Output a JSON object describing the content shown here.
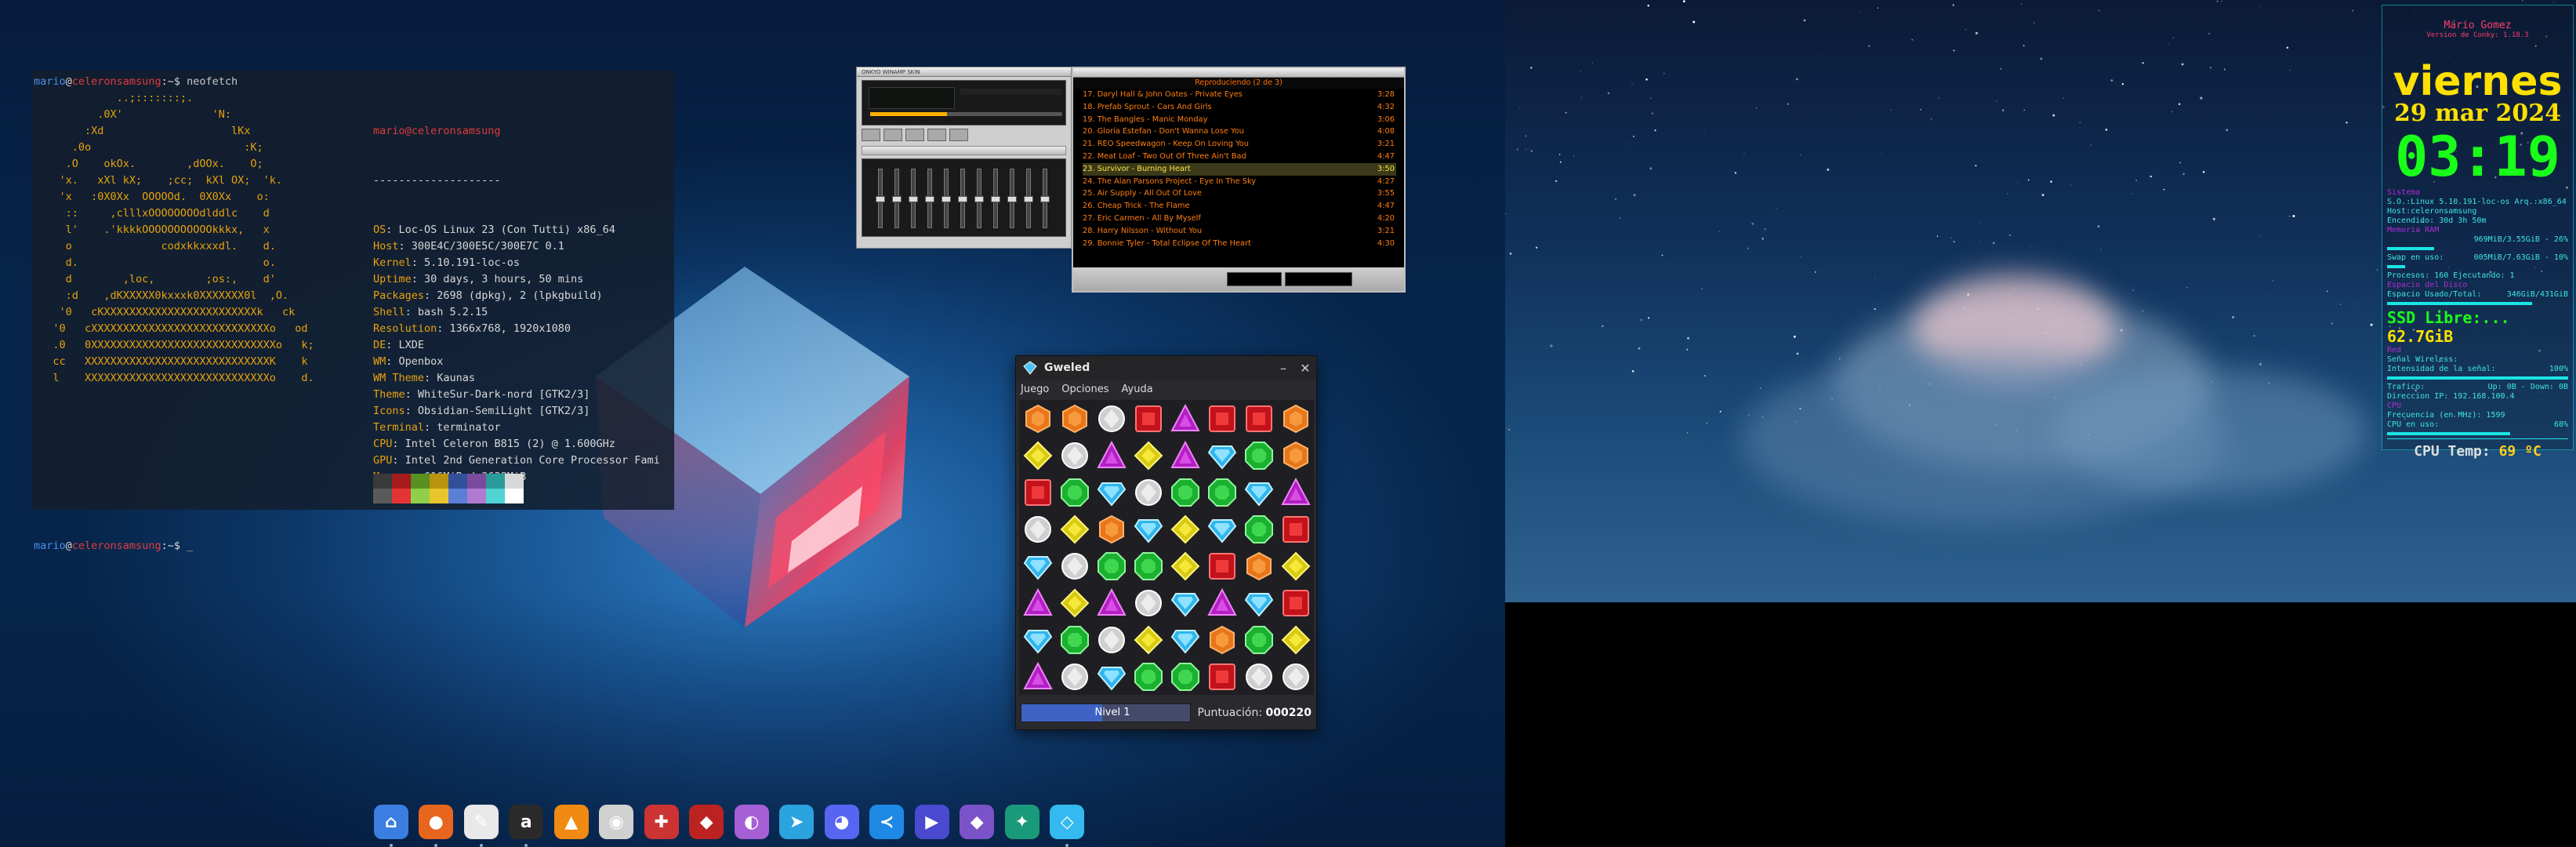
{
  "terminal": {
    "user": "mario",
    "host": "celeronsamsung",
    "command": "neofetch",
    "header": "mario@celeronsamsung",
    "separator": "--------------------",
    "info": [
      {
        "key": "OS",
        "value": "Loc-OS Linux 23 (Con Tutti) x86_64"
      },
      {
        "key": "Host",
        "value": "300E4C/300E5C/300E7C 0.1"
      },
      {
        "key": "Kernel",
        "value": "5.10.191-loc-os"
      },
      {
        "key": "Uptime",
        "value": "30 days, 3 hours, 50 mins"
      },
      {
        "key": "Packages",
        "value": "2698 (dpkg), 2 (lpkgbuild)"
      },
      {
        "key": "Shell",
        "value": "bash 5.2.15"
      },
      {
        "key": "Resolution",
        "value": "1366x768, 1920x1080"
      },
      {
        "key": "DE",
        "value": "LXDE"
      },
      {
        "key": "WM",
        "value": "Openbox"
      },
      {
        "key": "WM Theme",
        "value": "Kaunas"
      },
      {
        "key": "Theme",
        "value": "WhiteSur-Dark-nord [GTK2/3]"
      },
      {
        "key": "Icons",
        "value": "Obsidian-SemiLight [GTK2/3]"
      },
      {
        "key": "Terminal",
        "value": "terminator"
      },
      {
        "key": "CPU",
        "value": "Intel Celeron B815 (2) @ 1.600GHz"
      },
      {
        "key": "GPU",
        "value": "Intel 2nd Generation Core Processor Fami"
      },
      {
        "key": "Memory",
        "value": "616MiB / 3638MiB"
      }
    ],
    "swatch_colors": [
      "#3a3a3a",
      "#a61c1c",
      "#5a8f22",
      "#b8940f",
      "#32509a",
      "#7a4a9c",
      "#2b9a9a",
      "#d8d8d8",
      "#5a5a5a",
      "#e53434",
      "#8ed04a",
      "#e8c52c",
      "#5b7fd6",
      "#b07ad1",
      "#4fd3d3",
      "#ffffff"
    ],
    "cursor": "_"
  },
  "winamp": {
    "main_title": "ONKYO WINAMP SKIN",
    "playlist_header": "Reproduciendo (2 de 3)",
    "tracks": [
      {
        "title": "17. Daryl Hall & John Oates - Private Eyes",
        "time": "3:28"
      },
      {
        "title": "18. Prefab Sprout - Cars And Girls",
        "time": "4:32"
      },
      {
        "title": "19. The Bangles - Manic Monday",
        "time": "3:06"
      },
      {
        "title": "20. Gloria Estefan - Don't Wanna Lose You",
        "time": "4:08"
      },
      {
        "title": "21. REO Speedwagon - Keep On Loving You",
        "time": "3:21"
      },
      {
        "title": "22. Meat Loaf - Two Out Of Three Ain't Bad",
        "time": "4:47"
      },
      {
        "title": "23. Survivor - Burning Heart",
        "time": "3:50"
      },
      {
        "title": "24. The Alan Parsons Project - Eye In The Sky",
        "time": "4:27"
      },
      {
        "title": "25. Air Supply - All Out Of Love",
        "time": "3:55"
      },
      {
        "title": "26. Cheap Trick - The Flame",
        "time": "4:47"
      },
      {
        "title": "27. Eric Carmen - All By Myself",
        "time": "4:20"
      },
      {
        "title": "28. Harry Nilsson - Without You",
        "time": "3:21"
      },
      {
        "title": "29. Bonnie Tyler - Total Eclipse Of The Heart",
        "time": "4:30"
      }
    ],
    "current_index": 6
  },
  "gweled": {
    "title": "Gweled",
    "menu": [
      "Juego",
      "Opciones",
      "Ayuda"
    ],
    "level_label": "Nivel 1",
    "level_progress": 0.48,
    "score_label": "Puntuación:",
    "score_value": "000220",
    "board": [
      [
        "orange",
        "orange",
        "white",
        "red",
        "purple",
        "red",
        "red",
        "orange"
      ],
      [
        "yellow",
        "white",
        "purple",
        "yellow",
        "purple",
        "blue",
        "green",
        "orange"
      ],
      [
        "red",
        "green",
        "blue",
        "white",
        "green",
        "green",
        "blue",
        "purple"
      ],
      [
        "white",
        "yellow",
        "orange",
        "blue",
        "yellow",
        "blue",
        "green",
        "red"
      ],
      [
        "blue",
        "white",
        "green",
        "green",
        "yellow",
        "red",
        "orange",
        "yellow"
      ],
      [
        "purple",
        "yellow",
        "purple",
        "white",
        "blue",
        "purple",
        "blue",
        "red"
      ],
      [
        "blue",
        "green",
        "white",
        "yellow",
        "blue",
        "orange",
        "green",
        "yellow"
      ],
      [
        "purple",
        "white",
        "blue",
        "green",
        "green",
        "red",
        "white",
        "white"
      ]
    ]
  },
  "dock": [
    {
      "name": "home-folder-icon",
      "color": "#3b7de0",
      "glyph": "⌂"
    },
    {
      "name": "firefox-icon",
      "color": "#e8651d",
      "glyph": "●"
    },
    {
      "name": "text-editor-icon",
      "color": "#e8e8e8",
      "glyph": "✎"
    },
    {
      "name": "archive-icon",
      "color": "#2a2a2a",
      "glyph": "a"
    },
    {
      "name": "vlc-icon",
      "color": "#f08a12",
      "glyph": "▲"
    },
    {
      "name": "webcam-icon",
      "color": "#d0d0d0",
      "glyph": "◉"
    },
    {
      "name": "system-tool-icon",
      "color": "#c33",
      "glyph": "✚"
    },
    {
      "name": "gweled-red-icon",
      "color": "#b22",
      "glyph": "◆"
    },
    {
      "name": "purple-bird-icon",
      "color": "#a75fd6",
      "glyph": "◐"
    },
    {
      "name": "telegram-icon",
      "color": "#2aa3de",
      "glyph": "➤"
    },
    {
      "name": "discord-icon",
      "color": "#5865f2",
      "glyph": "◕"
    },
    {
      "name": "vscode-icon",
      "color": "#1e88e5",
      "glyph": "≺"
    },
    {
      "name": "media-player-icon",
      "color": "#4a4ad0",
      "glyph": "▶"
    },
    {
      "name": "obsidian-icon",
      "color": "#7b53c8",
      "glyph": "◆"
    },
    {
      "name": "dinosaur-icon",
      "color": "#1a9a7a",
      "glyph": "✦"
    },
    {
      "name": "diamond-icon",
      "color": "#34b9f0",
      "glyph": "◇"
    }
  ],
  "conky": {
    "name": "Mario Gomez",
    "version": "Version de Conky: 1.18.3",
    "day": "viernes",
    "date": "29 mar 2024",
    "time": "03:19",
    "sys_header": "Sistema",
    "so": "S.O.:Linux 5.10.191-loc-os Arq.:x86_64",
    "host": "Host:celeronsamsung",
    "uptime": "Encendido: 30d 3h 50m",
    "mem_header": "Memoria RAM",
    "mem": "969MiB/3.55GiB - 26%",
    "swap_label": "Swap en uso:",
    "swap": "005MiB/7.63GiB - 10%",
    "procs": "Procesos: 160  Ejecutando: 1",
    "disk_header": "Espacio del Disco",
    "disk_label": "Espacio Usado/Total:",
    "disk": "346GiB/431GiB",
    "ssd_label": "SSD Libre:...",
    "ssd_value": "62.7GiB",
    "net_header": "Red",
    "wifi": "Señal Wireless:",
    "wifi_int": "Intensidad de la señal:",
    "wifi_pct": "100%",
    "traffic": "Trafico:",
    "up": "Up: 0B",
    "down": "Down: 0B",
    "ip": "Direccion IP: 192.168.100.4",
    "cpu_header": "CPU",
    "freq": "Frecuencia (en MHz): 1599",
    "cpu_use": "CPU en uso:",
    "cpu_pct": "68%",
    "temp_label": "CPU Temp:",
    "temp_value": "69 ºC"
  }
}
